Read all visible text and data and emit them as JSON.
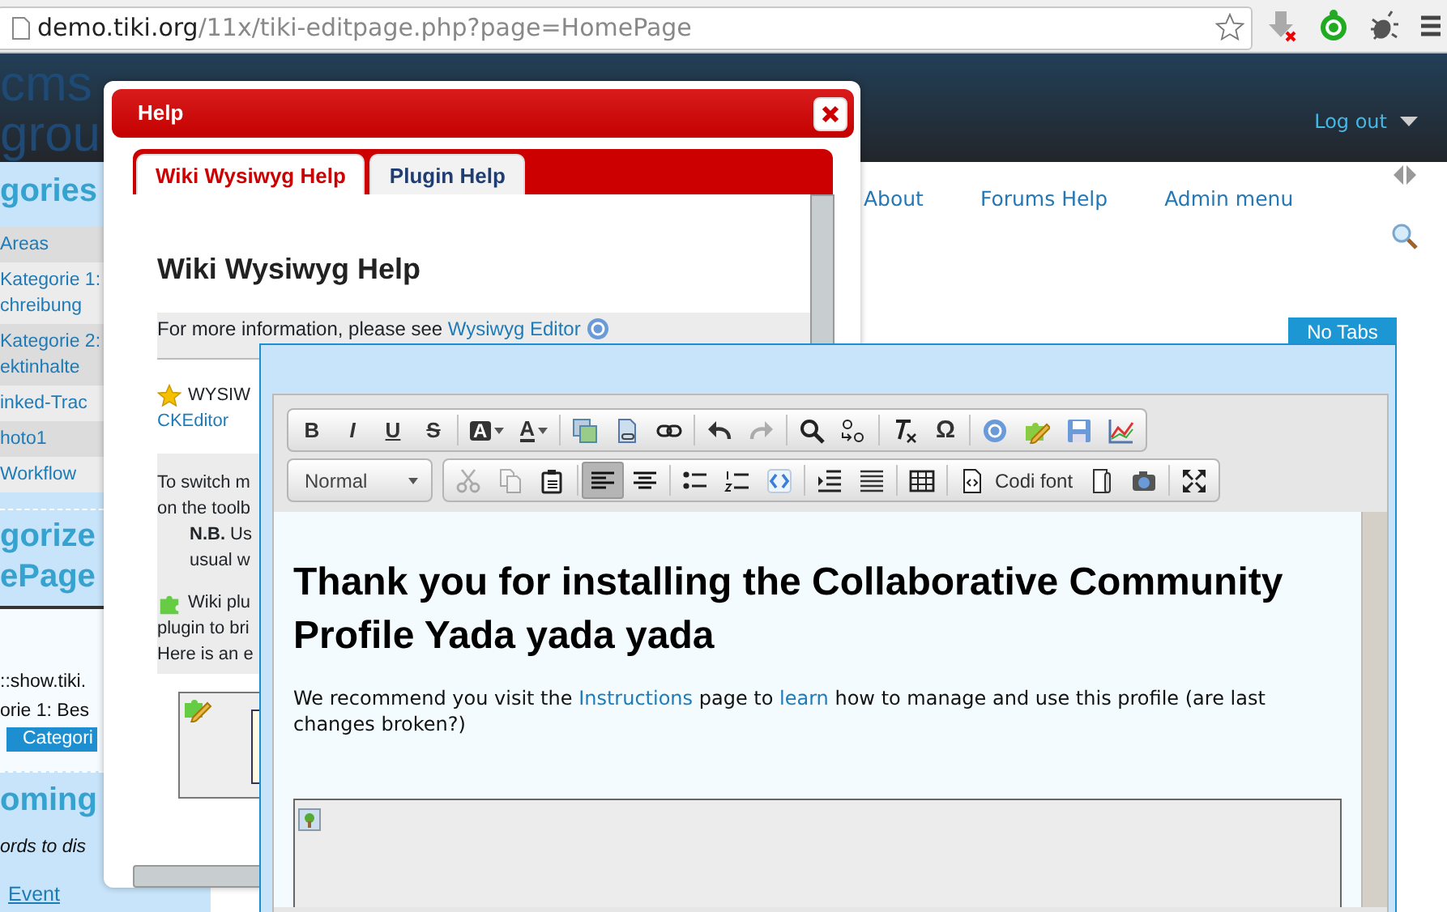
{
  "browser": {
    "url_host": "demo.tiki.org",
    "url_path": "/11x/tiki-editpage.php?page=HomePage"
  },
  "header": {
    "logo_lines": [
      "cms",
      "grou"
    ],
    "user_menu": "Log out"
  },
  "sidebar": {
    "title": "gories",
    "items": [
      {
        "lines": [
          "Areas"
        ]
      },
      {
        "lines": [
          "Kategorie 1:",
          "chreibung"
        ]
      },
      {
        "lines": [
          "Kategorie 2:",
          "ektinhalte"
        ]
      },
      {
        "lines": [
          "inked-Trac"
        ]
      },
      {
        "lines": [
          "hoto1"
        ]
      },
      {
        "lines": [
          "Workflow"
        ]
      }
    ],
    "categorize_title_lines": [
      "gorize",
      "ePage"
    ],
    "texts": [
      "::show.tiki.",
      "orie 1: Bes"
    ],
    "categorize_button": "Categori",
    "events_title": "oming",
    "events_note": "ords to dis",
    "event_link": "Event"
  },
  "nav": {
    "links": [
      "About",
      "Forums Help",
      "Admin menu"
    ]
  },
  "no_tabs_button": "No Tabs",
  "help_dialog": {
    "title": "Help",
    "tabs": [
      {
        "label": "Wiki Wysiwyg Help",
        "selected": true
      },
      {
        "label": "Plugin Help",
        "selected": false
      }
    ],
    "heading": "Wiki Wysiwyg Help",
    "info": {
      "text": "For more information, please see ",
      "link": "Wysiwyg Editor"
    },
    "blocks": [
      {
        "shaded": false,
        "lines": [
          {
            "kind": "starred",
            "text": "WYSIW"
          },
          {
            "kind": "link",
            "text": "CKEditor"
          }
        ]
      },
      {
        "shaded": true,
        "lines": [
          {
            "kind": "plain",
            "text": "To switch m"
          },
          {
            "kind": "plain",
            "text": "on the toolb"
          },
          {
            "kind": "note",
            "text": "**N.B.** Us"
          },
          {
            "kind": "note",
            "text": "usual w"
          },
          {
            "kind": "plugin",
            "text": "Wiki plu"
          },
          {
            "kind": "plain",
            "text": "plugin to bri"
          },
          {
            "kind": "plain",
            "text": "Here is an e"
          }
        ]
      }
    ]
  },
  "editor": {
    "toolbar_rows": [
      [
        {
          "kind": "bold",
          "glyph": "B",
          "pressed": false,
          "disabled": false
        },
        {
          "kind": "italic",
          "glyph": "I",
          "pressed": false,
          "disabled": false
        },
        {
          "kind": "underline",
          "glyph": "U",
          "pressed": false,
          "disabled": false
        },
        {
          "kind": "strike",
          "glyph": "S",
          "pressed": false,
          "disabled": false
        },
        {
          "kind": "sep"
        },
        {
          "kind": "bgcolor",
          "glyph": "A",
          "pressed": false,
          "disabled": false
        },
        {
          "kind": "textcolor",
          "glyph": "A",
          "pressed": false,
          "disabled": false
        },
        {
          "kind": "sep"
        },
        {
          "kind": "image",
          "pressed": false,
          "disabled": false
        },
        {
          "kind": "filelink",
          "pressed": false,
          "disabled": false
        },
        {
          "kind": "link",
          "pressed": false,
          "disabled": false
        },
        {
          "kind": "sep"
        },
        {
          "kind": "undo",
          "pressed": false,
          "disabled": false
        },
        {
          "kind": "redo",
          "pressed": false,
          "disabled": true
        },
        {
          "kind": "sep"
        },
        {
          "kind": "find",
          "pressed": false,
          "disabled": false
        },
        {
          "kind": "replace",
          "pressed": false,
          "disabled": false
        },
        {
          "kind": "sep"
        },
        {
          "kind": "removeformat",
          "pressed": false,
          "disabled": false
        },
        {
          "kind": "special",
          "glyph": "Ω",
          "pressed": false,
          "disabled": false
        },
        {
          "kind": "sep"
        },
        {
          "kind": "help",
          "pressed": false,
          "disabled": false
        },
        {
          "kind": "plugin",
          "pressed": false,
          "disabled": false
        },
        {
          "kind": "save",
          "pressed": false,
          "disabled": false
        },
        {
          "kind": "chart",
          "pressed": false,
          "disabled": false
        }
      ],
      [
        {
          "kind": "select",
          "text": "Normal"
        },
        {
          "kind": "group"
        },
        {
          "kind": "cut",
          "pressed": false,
          "disabled": true
        },
        {
          "kind": "copy",
          "pressed": false,
          "disabled": true
        },
        {
          "kind": "paste",
          "pressed": false,
          "disabled": false
        },
        {
          "kind": "sep"
        },
        {
          "kind": "alignleft",
          "pressed": true,
          "disabled": false
        },
        {
          "kind": "center",
          "pressed": false,
          "disabled": false
        },
        {
          "kind": "sep"
        },
        {
          "kind": "bullets",
          "pressed": false,
          "disabled": false
        },
        {
          "kind": "numbers",
          "pressed": false,
          "disabled": false
        },
        {
          "kind": "source",
          "pressed": false,
          "disabled": false
        },
        {
          "kind": "sep"
        },
        {
          "kind": "indent",
          "pressed": false,
          "disabled": false
        },
        {
          "kind": "rule",
          "pressed": false,
          "disabled": false
        },
        {
          "kind": "sep"
        },
        {
          "kind": "table",
          "pressed": false,
          "disabled": false
        },
        {
          "kind": "sep"
        },
        {
          "kind": "codefont",
          "text": "Codi font",
          "pressed": false,
          "disabled": false
        },
        {
          "kind": "page",
          "pressed": false,
          "disabled": false
        },
        {
          "kind": "camera",
          "pressed": false,
          "disabled": false
        },
        {
          "kind": "sep"
        },
        {
          "kind": "maximize",
          "pressed": false,
          "disabled": false
        }
      ]
    ],
    "heading": "Thank you for installing the Collaborative Community Profile Yada yada yada",
    "paragraph": [
      {
        "kind": "text",
        "text": "We recommend you visit the "
      },
      {
        "kind": "link",
        "text": "Instructions"
      },
      {
        "kind": "text",
        "text": " page to "
      },
      {
        "kind": "link",
        "text": "learn"
      },
      {
        "kind": "text",
        "text": " how to manage and use this profile (are last changes broken?)"
      }
    ]
  }
}
